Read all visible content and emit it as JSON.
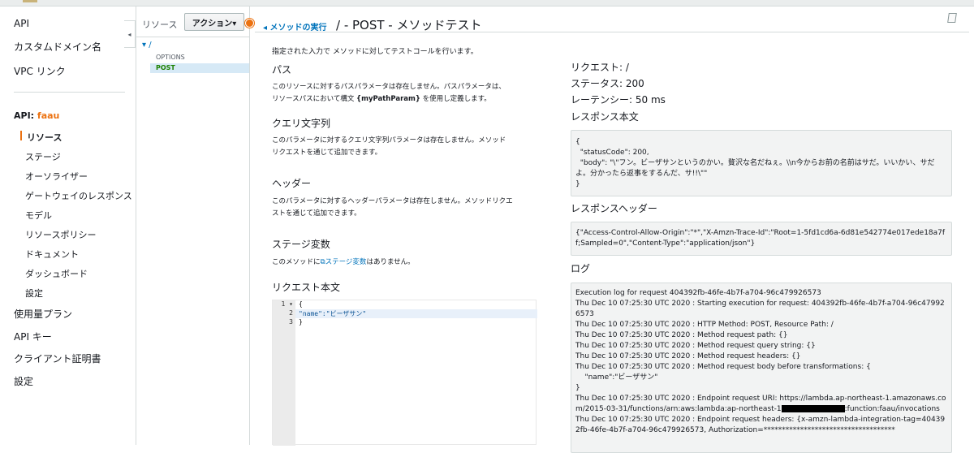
{
  "nav": {
    "top_items": [
      "API",
      "カスタムドメイン名",
      "VPC リンク"
    ],
    "api_prefix": "API:",
    "api_name": "faau",
    "sub_items": [
      "リソース",
      "ステージ",
      "オーソライザー",
      "ゲートウェイのレスポンス",
      "モデル",
      "リソースポリシー",
      "ドキュメント",
      "ダッシュボード",
      "設定"
    ],
    "bottom_items": [
      "使用量プラン",
      "API キー",
      "クライアント証明書",
      "設定"
    ]
  },
  "tree": {
    "title": "リソース",
    "actions_label": "アクション▾",
    "root": "▾ /",
    "options": "OPTIONS",
    "post": "POST"
  },
  "header": {
    "back_link": "◂ メソッドの実行",
    "title": "/ - POST - メソッドテスト"
  },
  "left": {
    "intro": "指定された入力で メソッドに対してテストコールを行います。",
    "path_h": "パス",
    "path_p1": "このリソースに対するパスパラメータは存在しません。パスパラメータは、",
    "path_p2a": "リソースパスにおいて構文 ",
    "path_p2b": "{myPathParam}",
    "path_p2c": " を使用し定義します。",
    "query_h": "クエリ文字列",
    "query_p1": "このパラメータに対するクエリ文字列パラメータは存在しません。メソッド",
    "query_p2": "リクエストを通じて追加できます。",
    "headers_h": "ヘッダー",
    "headers_p1": "このパラメータに対するヘッダーパラメータは存在しません。メソッドリクエ",
    "headers_p2": "ストを通じて追加できます。",
    "stage_h": "ステージ変数",
    "stage_p_a": "このメソッドに",
    "stage_p_link": "ステージ変数",
    "stage_p_b": "はありません。",
    "body_h": "リクエスト本文",
    "code_lines": [
      "{",
      "    \"name\":\"ビーザサン\"",
      "}"
    ],
    "line_numbers": [
      "1 ▾",
      "2",
      "3"
    ]
  },
  "right": {
    "request": "リクエスト: /",
    "status": "ステータス: 200",
    "latency": "レーテンシー: 50 ms",
    "resp_body_h": "レスポンス本文",
    "resp_body": "{\n  \"statusCode\": 200,\n  \"body\": \"\\\"フン。ビーザサンというのかい。贅沢な名だねぇ。\\\\n今からお前の名前はサだ。いいかい、サだよ。分かったら返事をするんだ、サ!!\\\"\"\n}",
    "resp_headers_h": "レスポンスヘッダー",
    "resp_headers": "{\"Access-Control-Allow-Origin\":\"*\",\"X-Amzn-Trace-Id\":\"Root=1-5fd1cd6a-6d81e542774e017ede18a7ff;Sampled=0\",\"Content-Type\":\"application/json\"}",
    "log_h": "ログ",
    "log_a": "Execution log for request 404392fb-46fe-4b7f-a704-96c479926573\nThu Dec 10 07:25:30 UTC 2020 : Starting execution for request: 404392fb-46fe-4b7f-a704-96c479926573\nThu Dec 10 07:25:30 UTC 2020 : HTTP Method: POST, Resource Path: /\nThu Dec 10 07:25:30 UTC 2020 : Method request path: {}\nThu Dec 10 07:25:30 UTC 2020 : Method request query string: {}\nThu Dec 10 07:25:30 UTC 2020 : Method request headers: {}\nThu Dec 10 07:25:30 UTC 2020 : Method request body before transformations: {\n    \"name\":\"ビーザサン\"\n}\nThu Dec 10 07:25:30 UTC 2020 : Endpoint request URI: https://lambda.ap-northeast-1.amazonaws.com/2015-03-31/functions/arn:aws:lambda:ap-northeast-1",
    "log_b": ":function:faau/invocations\nThu Dec 10 07:25:30 UTC 2020 : Endpoint request headers: {x-amzn-lambda-integration-tag=404392fb-46fe-4b7f-a704-96c479926573, Authorization=************************************"
  }
}
